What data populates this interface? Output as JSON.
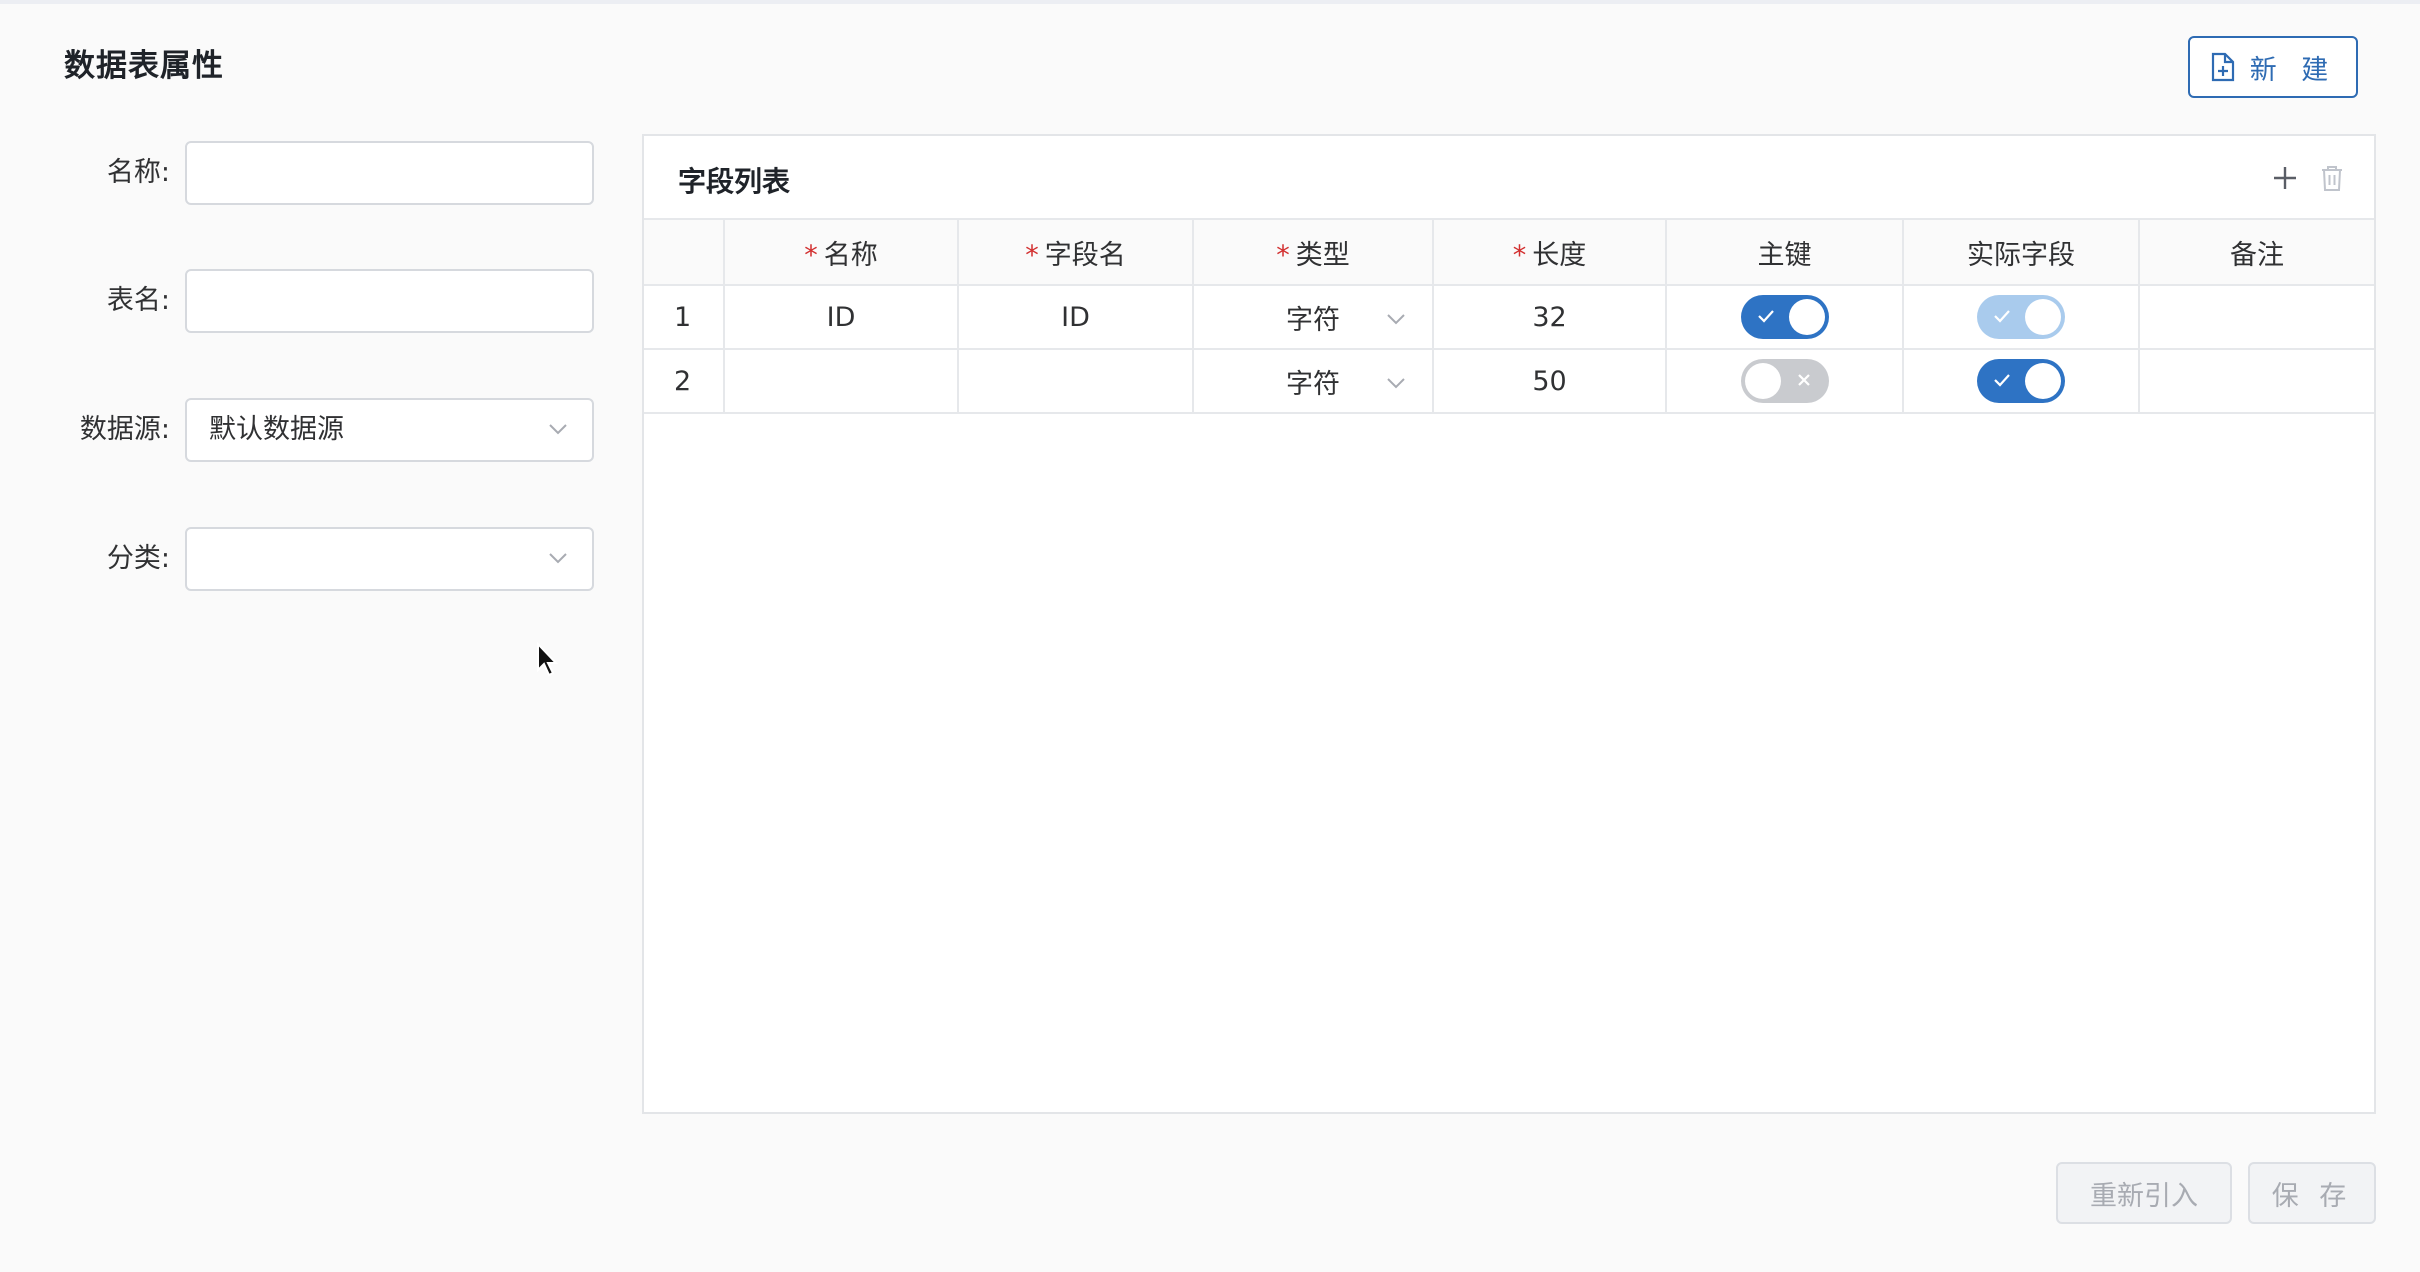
{
  "page": {
    "title": "数据表属性",
    "new_button": "新 建"
  },
  "form": {
    "name_label": "名称:",
    "name_value": "",
    "table_label": "表名:",
    "table_value": "",
    "datasource_label": "数据源:",
    "datasource_value": "默认数据源",
    "category_label": "分类:",
    "category_value": ""
  },
  "panel": {
    "title": "字段列表",
    "columns": {
      "name": "名称",
      "field_name": "字段名",
      "type": "类型",
      "length": "长度",
      "primary_key": "主键",
      "actual_field": "实际字段",
      "remark": "备注"
    },
    "required_mark": "*",
    "rows": [
      {
        "index": "1",
        "name": "ID",
        "field_name": "ID",
        "type": "字符",
        "length": "32",
        "primary_key": true,
        "primary_key_disabled": false,
        "actual_field": true,
        "actual_field_disabled": true,
        "remark": ""
      },
      {
        "index": "2",
        "name": "",
        "field_name": "",
        "type": "字符",
        "length": "50",
        "primary_key": false,
        "primary_key_disabled": false,
        "actual_field": true,
        "actual_field_disabled": false,
        "remark": ""
      }
    ]
  },
  "footer": {
    "reimport_button": "重新引入",
    "save_button": "保 存"
  },
  "colors": {
    "primary": "#2e73c4",
    "required": "#d22f2f",
    "switch_off": "#c9cbcf",
    "switch_disabled_on": "#a9cbed"
  }
}
